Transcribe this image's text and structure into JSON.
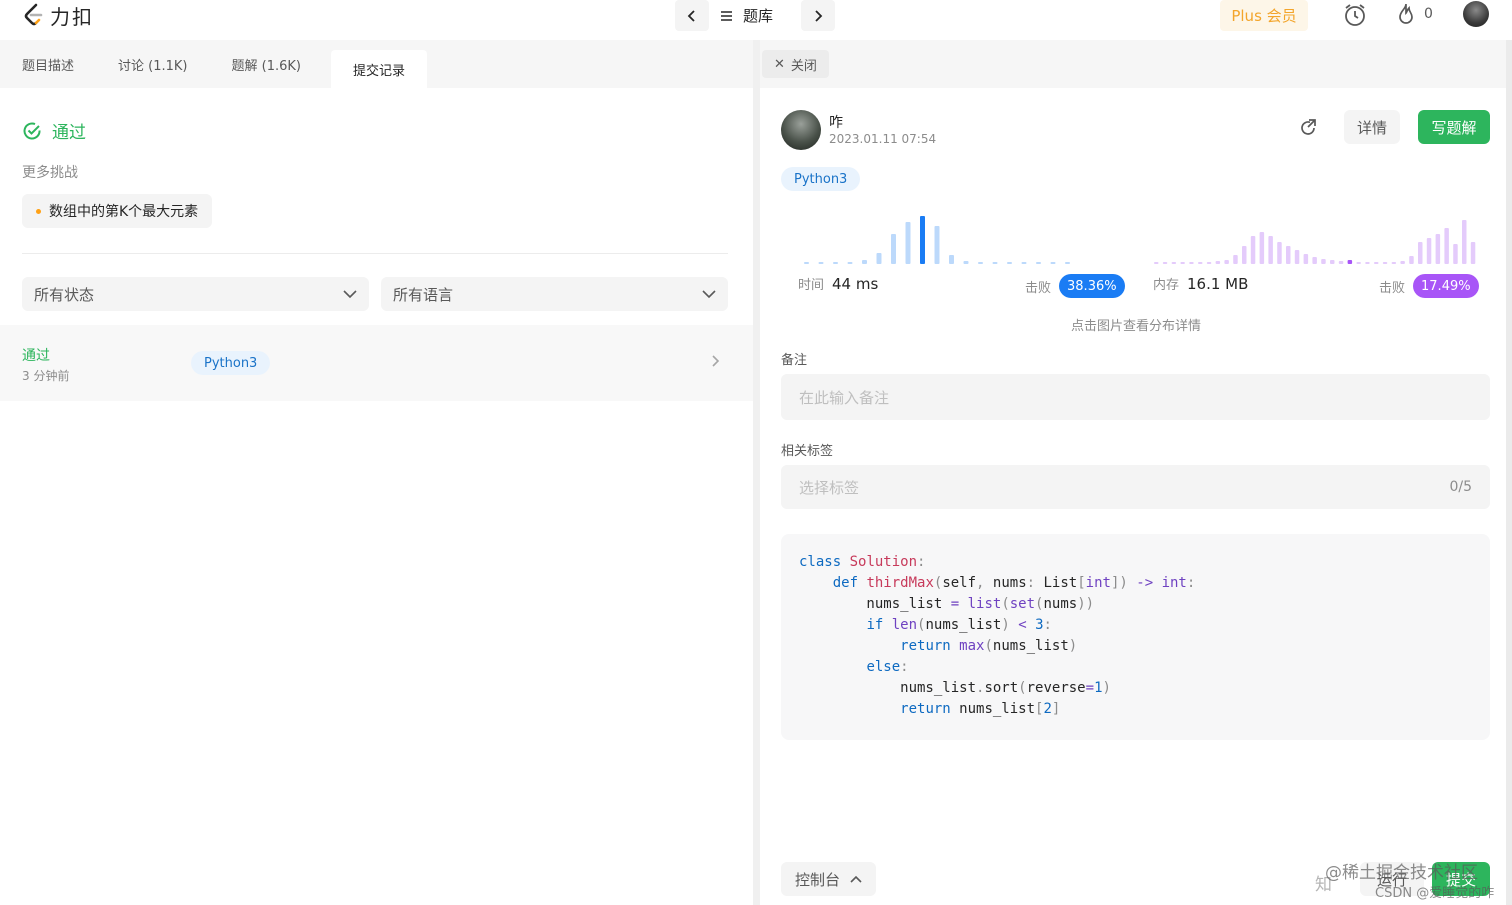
{
  "header": {
    "logo_text": "力扣",
    "problem_bank": "题库",
    "plus": "Plus 会员",
    "fire_count": "0"
  },
  "left": {
    "tabs": [
      {
        "label": "题目描述"
      },
      {
        "label": "讨论 (1.1K)"
      },
      {
        "label": "题解 (1.6K)"
      },
      {
        "label": "提交记录"
      }
    ],
    "result": "通过",
    "more_challenges": "更多挑战",
    "challenge": "数组中的第K个最大元素",
    "filter_status": "所有状态",
    "filter_language": "所有语言",
    "submissions": [
      {
        "status": "通过",
        "time": "3 分钟前",
        "language": "Python3"
      }
    ]
  },
  "right": {
    "close_label": "关闭",
    "user": {
      "name": "咋",
      "date": "2023.01.11 07:54"
    },
    "detail_button": "详情",
    "write_solution_button": "写题解",
    "language": "Python3",
    "runtime": {
      "label": "时间",
      "value": "44 ms",
      "beat_label": "击败",
      "beat": "38.36%"
    },
    "memory": {
      "label": "内存",
      "value": "16.1 MB",
      "beat_label": "击败",
      "beat": "17.49%"
    },
    "chart_hint": "点击图片查看分布详情",
    "note_label": "备注",
    "note_placeholder": "在此输入备注",
    "tags_label": "相关标签",
    "tags_placeholder": "选择标签",
    "tags_count": "0/5",
    "console_label": "控制台",
    "run_label": "运行",
    "submit_label": "提交",
    "watermark_1": "@稀土掘金技术社区",
    "watermark_2": "CSDN @爱睡觉的咋",
    "watermark_icon": "知"
  },
  "colors": {
    "accent_green": "#2db55d",
    "runtime_blue": "#1a7cf4",
    "memory_purple": "#a855f7"
  }
}
